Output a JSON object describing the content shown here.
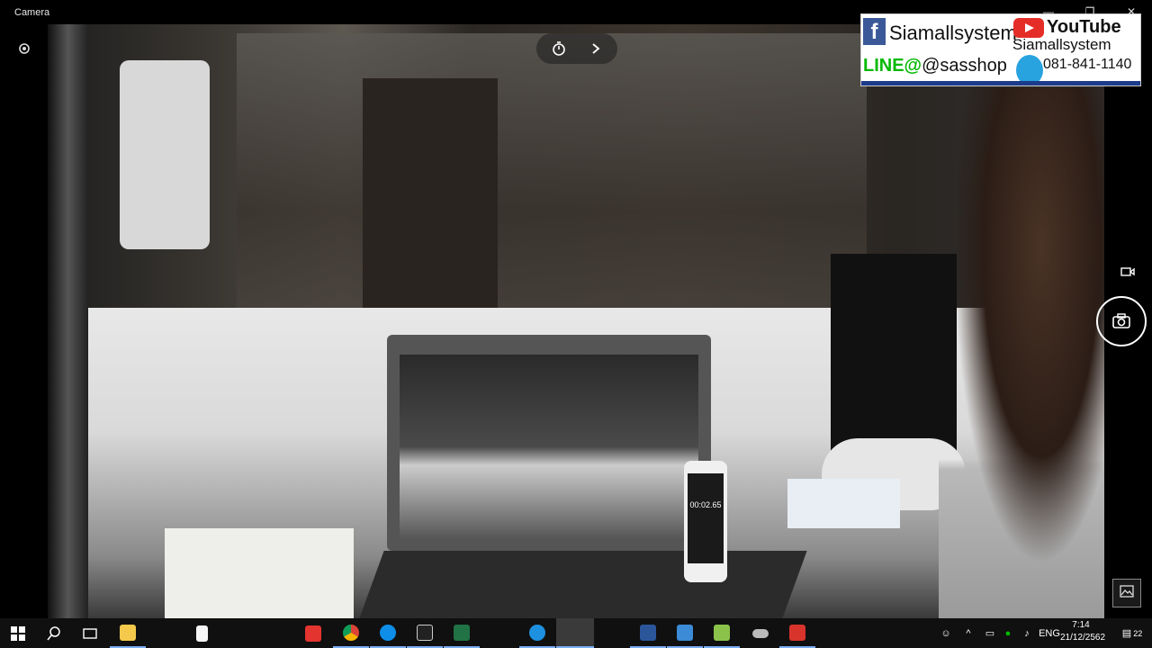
{
  "window": {
    "title": "Camera",
    "controls": {
      "minimize": "—",
      "maximize": "❐",
      "close": "✕"
    }
  },
  "camera": {
    "timer_icon": "timer-icon",
    "expand_icon": "chevron-right-icon",
    "settings_icon": "settings-icon",
    "video_mode_icon": "video-icon",
    "shutter_icon": "camera-icon",
    "gallery_icon": "gallery-icon",
    "phone_screen_text": "00:02.65"
  },
  "banner": {
    "facebook_name": "Siamallsystem",
    "youtube_label": "YouTube",
    "youtube_name": "Siamallsystem",
    "line_label": "LINE@",
    "line_id": "@sasshop",
    "phone": "081-841-1140",
    "colors": {
      "facebook": "#3b5998",
      "youtube": "#e52d27",
      "line": "#00b900"
    }
  },
  "taskbar": {
    "apps": [
      "start-icon",
      "search-icon",
      "task-view-icon",
      "file-explorer-icon",
      "notepad-icon",
      "acrobat-icon",
      "chrome-icon",
      "teamviewer-icon",
      "terminal-icon",
      "excel-icon",
      "edge-icon",
      "camera-app-icon",
      "visio-icon",
      "remote-desktop-icon",
      "notepadplus-icon",
      "cloud-icon",
      "app-s-icon"
    ],
    "tray": {
      "language": "ENG",
      "time": "7:14",
      "date": "21/12/2562",
      "notifications": "22"
    }
  }
}
